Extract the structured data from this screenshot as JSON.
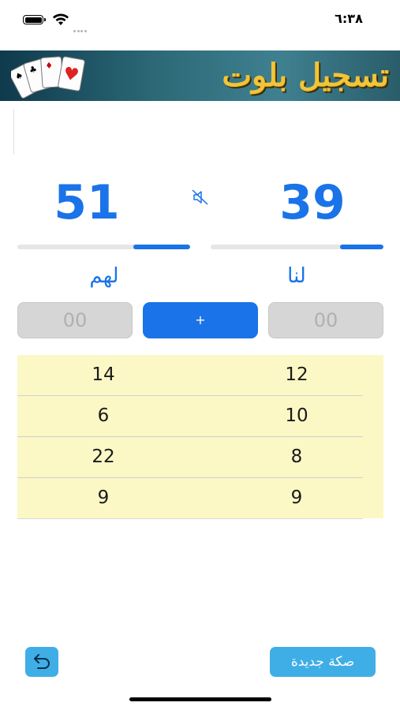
{
  "status_bar": {
    "time": "٦:٣٨",
    "battery_icon": "battery-icon",
    "wifi_icon": "wifi-icon",
    "signal_icon": "cellular-signal-icon"
  },
  "banner": {
    "title": "تسجيل بلوت",
    "cards_icon": "playing-cards-icon"
  },
  "scores": {
    "left": "51",
    "right": "39",
    "mute_icon": "speaker-muted-icon"
  },
  "progress": {
    "left_fraction": 0.33,
    "right_fraction": 0.25,
    "accent": "#1a73e8"
  },
  "teams": {
    "left_label": "لهم",
    "right_label": "لنا"
  },
  "entry": {
    "left_placeholder": "00",
    "right_placeholder": "00",
    "add_label": "+"
  },
  "rounds": [
    {
      "left": "14",
      "right": "12"
    },
    {
      "left": "6",
      "right": "10"
    },
    {
      "left": "22",
      "right": "8"
    },
    {
      "left": "9",
      "right": "9"
    }
  ],
  "footer": {
    "undo_icon": "undo-arrow-icon",
    "new_game_label": "صكة جديدة"
  }
}
